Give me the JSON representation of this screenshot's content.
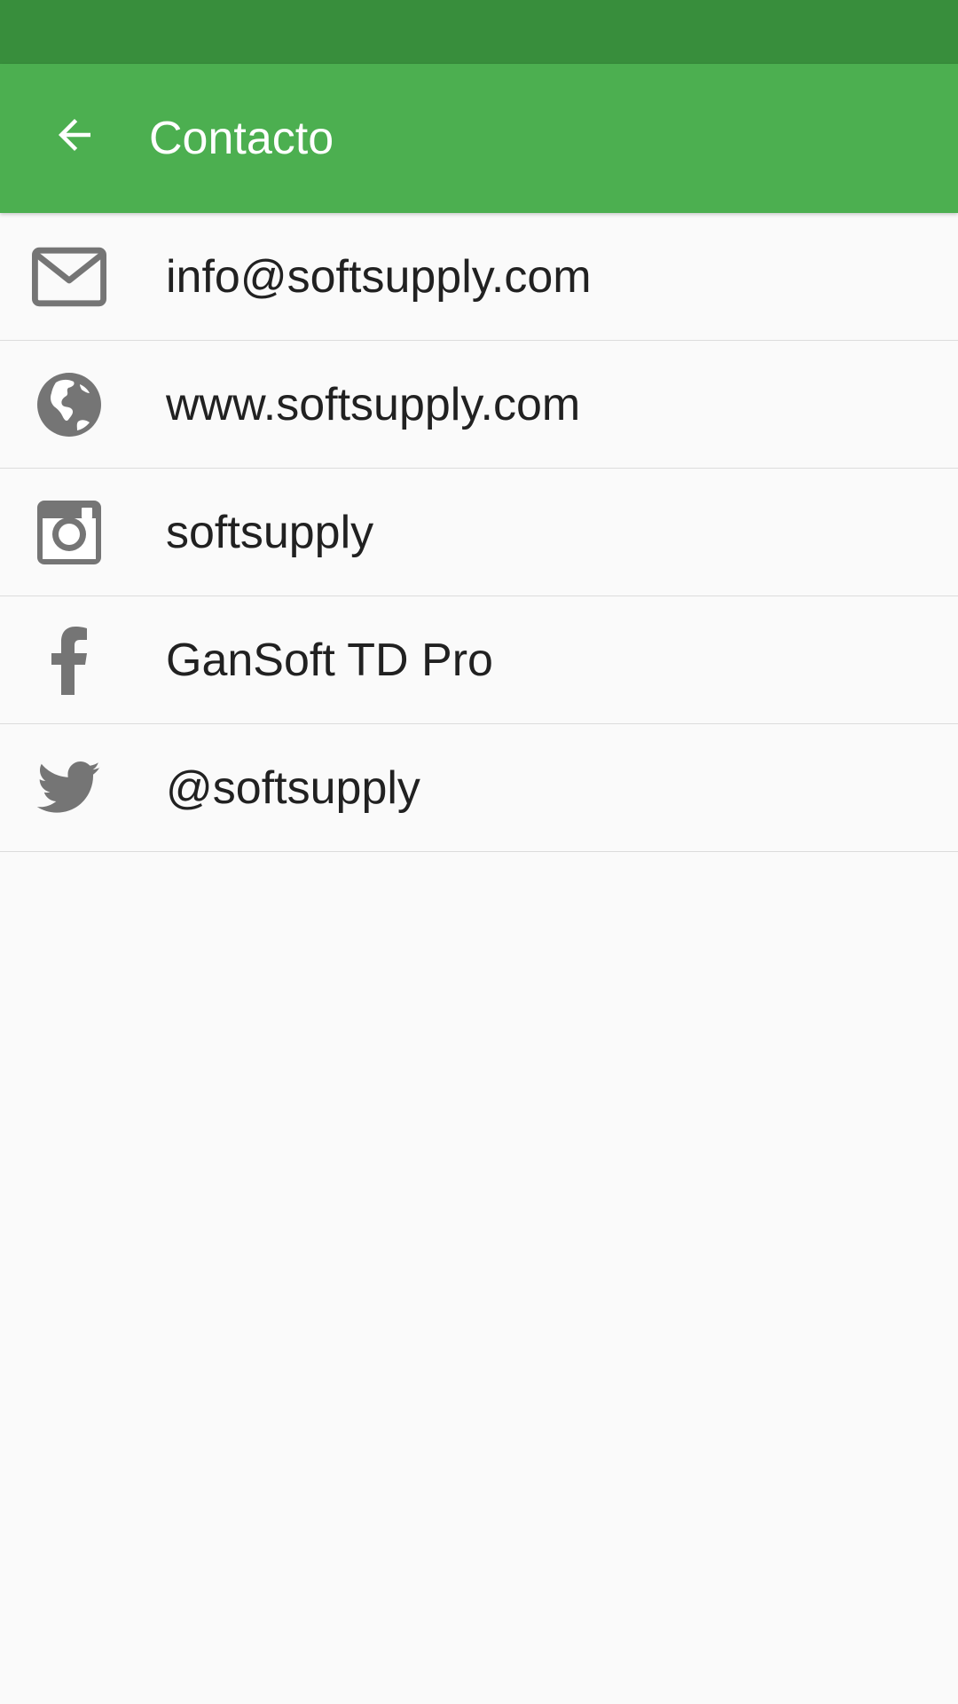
{
  "status_bar": {
    "color": "#388e3c"
  },
  "app_bar": {
    "title": "Contacto",
    "color": "#4caf50",
    "back_icon": "arrow-back-icon"
  },
  "contacts": [
    {
      "icon": "mail-icon",
      "label": "info@softsupply.com"
    },
    {
      "icon": "globe-icon",
      "label": "www.softsupply.com"
    },
    {
      "icon": "instagram-icon",
      "label": "softsupply"
    },
    {
      "icon": "facebook-icon",
      "label": "GanSoft TD Pro"
    },
    {
      "icon": "twitter-icon",
      "label": "@softsupply"
    }
  ],
  "icon_color": "#757575"
}
